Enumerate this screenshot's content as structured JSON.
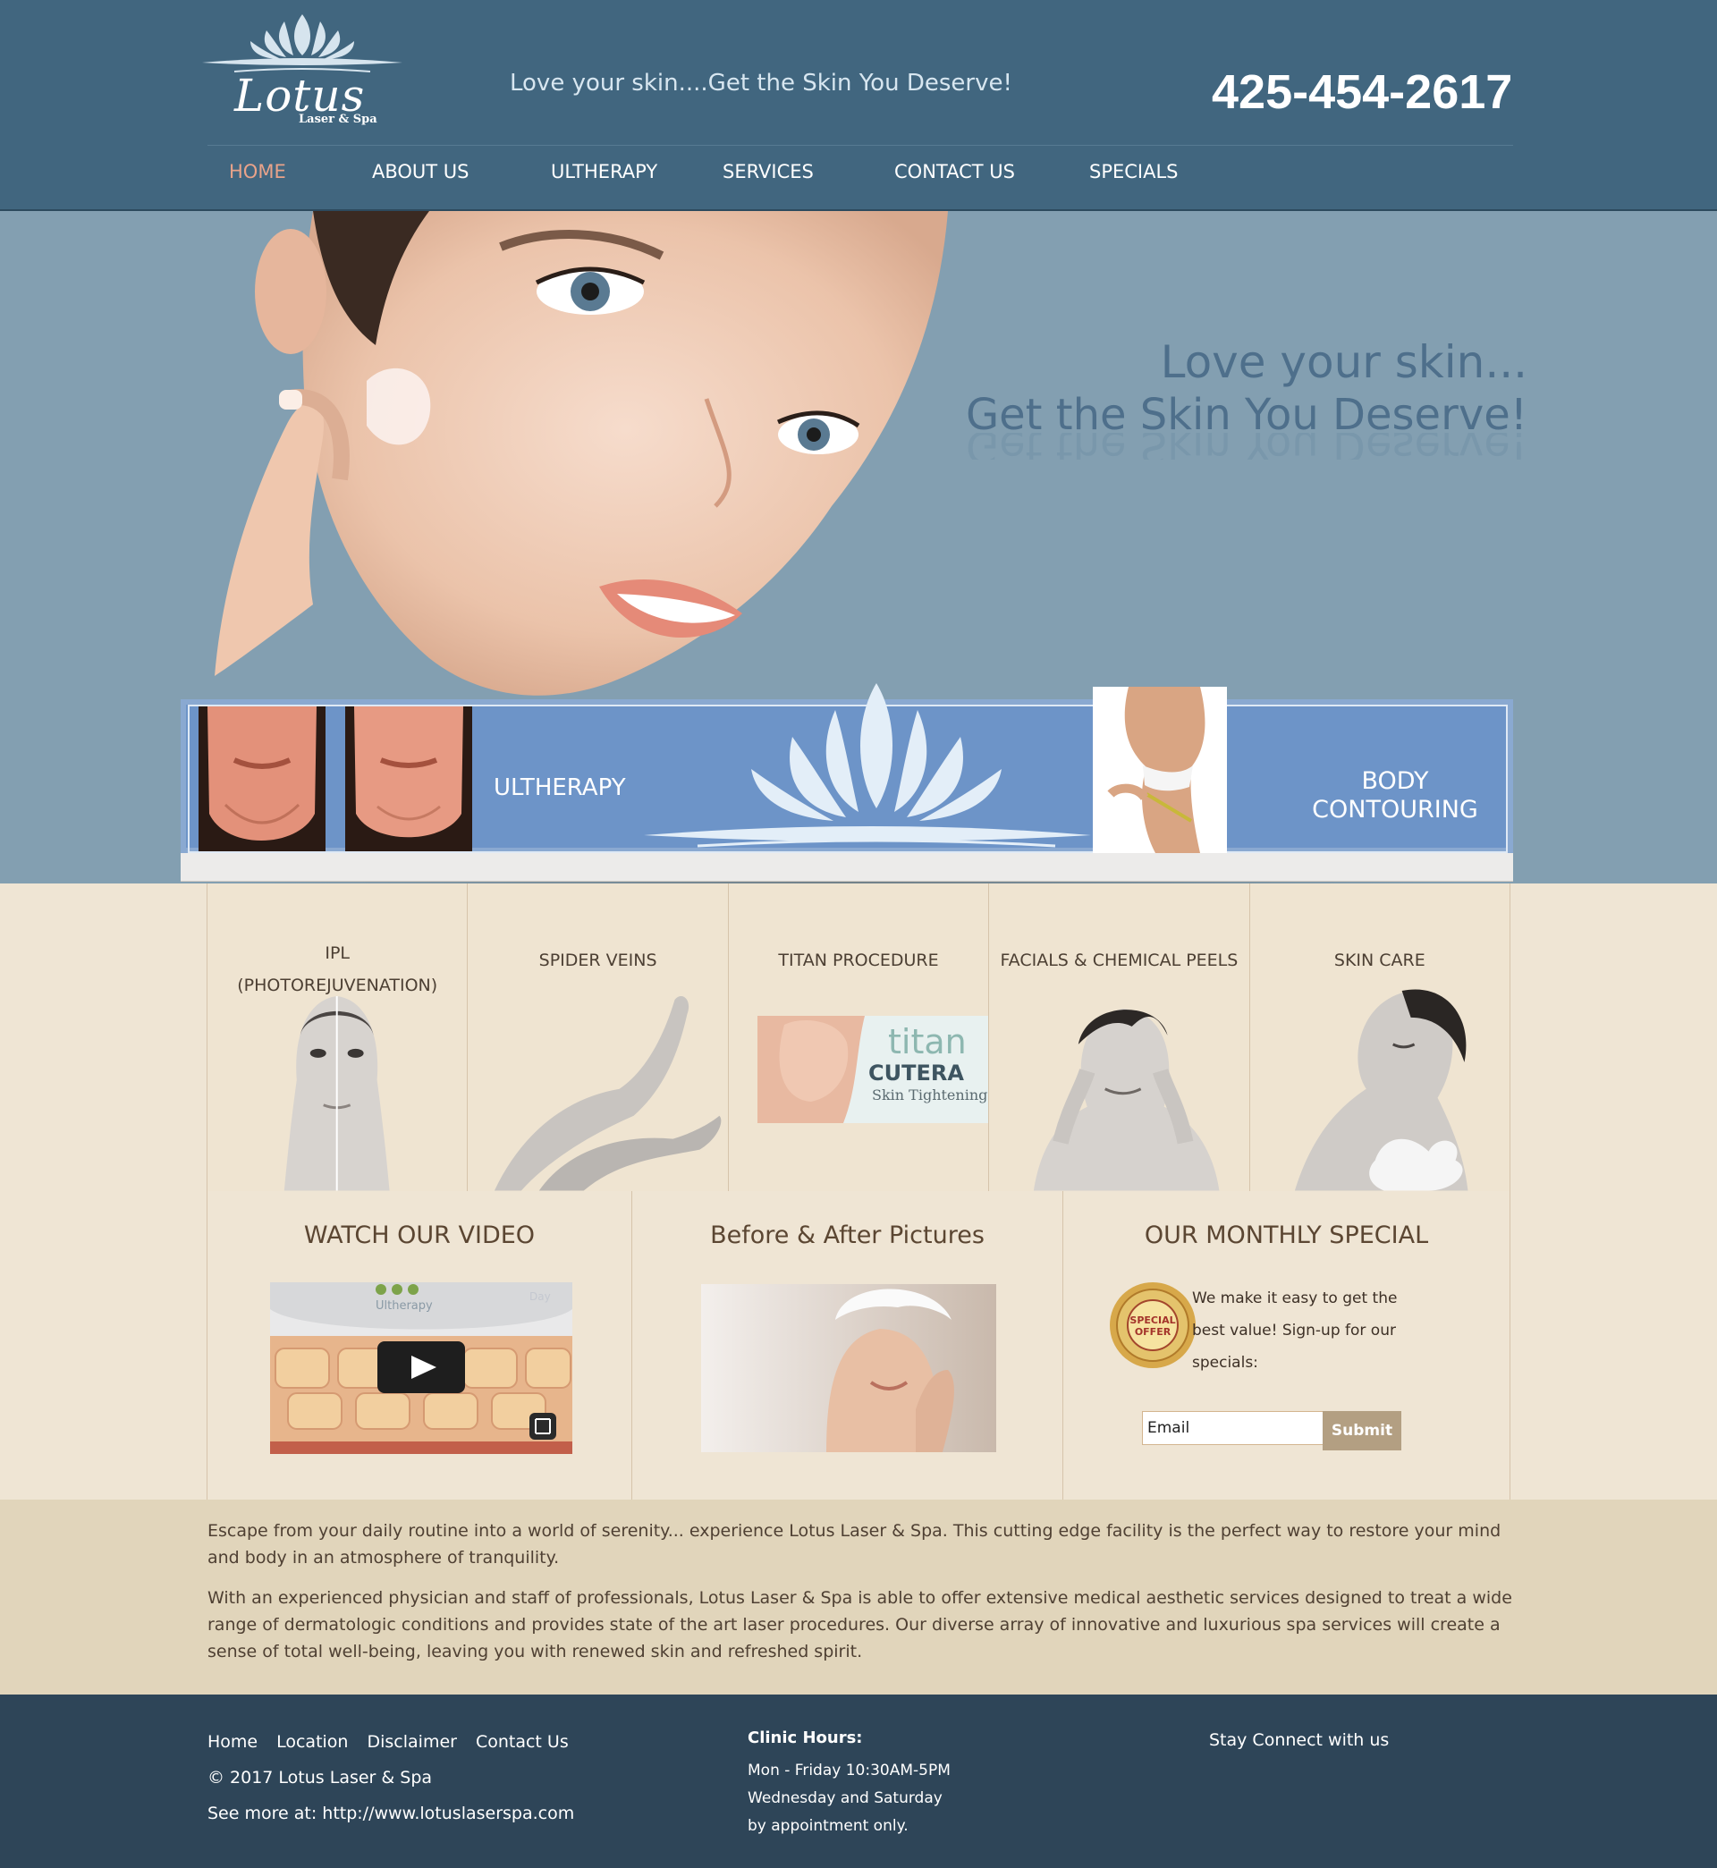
{
  "header": {
    "logo_script": "Lotus",
    "logo_sub": "Laser & Spa",
    "tagline": "Love your skin....Get the Skin You Deserve!",
    "phone": "425-454-2617"
  },
  "nav": {
    "items": [
      {
        "label": "HOME",
        "active": true
      },
      {
        "label": "ABOUT US"
      },
      {
        "label": "ULTHERAPY"
      },
      {
        "label": "SERVICES"
      },
      {
        "label": "CONTACT US"
      },
      {
        "label": "SPECIALS"
      }
    ]
  },
  "hero": {
    "line1": "Love your skin...",
    "line2": "Get the Skin You Deserve!"
  },
  "banner": {
    "ultherapy_label": "ULTHERAPY",
    "body_label_1": "BODY",
    "body_label_2": "CONTOURING"
  },
  "services": [
    {
      "line1": "IPL",
      "line2": "(PHOTOREJUVENATION)"
    },
    {
      "line1": "SPIDER VEINS",
      "line2": ""
    },
    {
      "line1": "TITAN PROCEDURE",
      "line2": ""
    },
    {
      "line1": "FACIALS & CHEMICAL PEELS",
      "line2": ""
    },
    {
      "line1": "SKIN CARE",
      "line2": ""
    }
  ],
  "titan_image_text": {
    "brand": "titan",
    "maker": "CUTERA",
    "caption": "Skin Tightening"
  },
  "video_thumb_text": {
    "brand": "Ultherapy",
    "corner": "Day"
  },
  "panels": {
    "video_title": "WATCH OUR VIDEO",
    "before_after_title": "Before & After Pictures",
    "special_title": "OUR MONTHLY SPECIAL",
    "special_text": "We make it easy to get the best value! Sign-up for our specials:",
    "badge_text_1": "SPECIAL",
    "badge_text_2": "OFFER",
    "email_placeholder": "Email",
    "submit_label": "Submit"
  },
  "about": {
    "p1": "Escape from your daily routine into a world of serenity... experience Lotus Laser & Spa. This cutting edge facility is the perfect way to restore your mind and body in an atmosphere of tranquility.",
    "p2": "With an experienced physician and staff of professionals, Lotus Laser & Spa is able to offer extensive medical aesthetic services designed to treat a wide range of dermatologic conditions and provides state of the art laser procedures. Our diverse array of innovative and luxurious spa services will create a sense of total well-being, leaving you with renewed skin and refreshed spirit."
  },
  "footer": {
    "links": [
      "Home",
      "Location",
      "Disclaimer",
      "Contact Us"
    ],
    "copyright": "© 2017 Lotus Laser & Spa",
    "see_more_prefix": "See more at: ",
    "see_more_url": "http://www.lotuslaserspa.com",
    "hours_title": "Clinic Hours:",
    "hours_line1": "Mon - Friday 10:30AM-5PM",
    "hours_line2": "Wednesday and Saturday",
    "hours_line3": "by appointment only.",
    "stay_connected": "Stay Connect with us"
  },
  "colors": {
    "header_bg": "#41667f",
    "hero_bg": "#839fb1",
    "nav_active": "#e9a38a",
    "banner_blue": "#6d94c8",
    "page_cream": "#efe5d4",
    "about_bg": "#e1d5bb",
    "footer_bg": "#2e4558",
    "submit_bg": "#b39f82"
  }
}
